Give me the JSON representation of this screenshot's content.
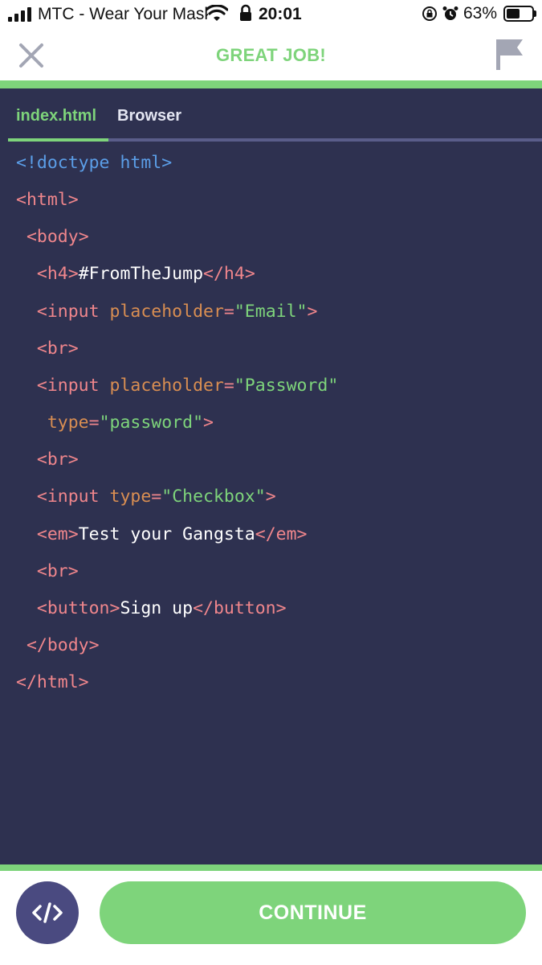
{
  "status_bar": {
    "carrier": "MTC - Wear Your Mask",
    "time": "20:01",
    "battery": "63%",
    "battery_level": 0.63,
    "icons": [
      "signal-icon",
      "wifi-icon",
      "lock-icon",
      "rotation-lock-icon",
      "alarm-icon",
      "battery-icon"
    ]
  },
  "header": {
    "title": "GREAT JOB!",
    "close_icon": "close-icon",
    "flag_icon": "flag-icon"
  },
  "tabs": [
    {
      "label": "index.html",
      "active": true
    },
    {
      "label": "Browser",
      "active": false
    }
  ],
  "code": {
    "lines": [
      "<!doctype html>",
      "<html>",
      " <body>",
      "  <h4>#FromTheJump</h4>",
      "  <input placeholder=\"Email\">",
      "  <br>",
      "  <input placeholder=\"Password\"",
      "   type=\"password\">",
      "  <br>",
      "  <input type=\"Checkbox\">",
      "  <em>Test your Gangsta</em>",
      "  <br>",
      "  <button>Sign up</button>",
      " </body>",
      "</html>"
    ]
  },
  "footer": {
    "continue_label": "CONTINUE",
    "code_icon": "code-icon"
  },
  "colors": {
    "accent": "#7ed47b",
    "editor_bg": "#2e3150",
    "tag": "#f0868c",
    "attribute": "#d98e52",
    "string": "#7ed47b",
    "doctype": "#5b9ee8",
    "code_button": "#4a4a80"
  }
}
